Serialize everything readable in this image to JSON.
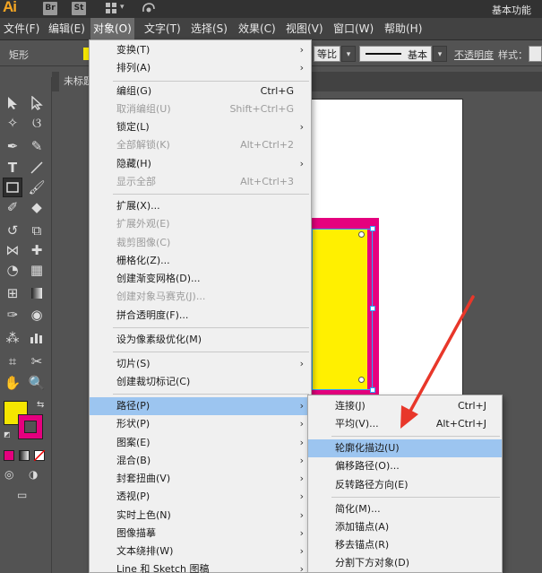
{
  "titlebar": {
    "app_logo": "Ai",
    "badge_br": "Br",
    "badge_st": "St",
    "workspace": "基本功能"
  },
  "menubar": {
    "items": [
      "文件(F)",
      "编辑(E)",
      "对象(O)",
      "文字(T)",
      "选择(S)",
      "效果(C)",
      "视图(V)",
      "窗口(W)",
      "帮助(H)"
    ]
  },
  "controlbar": {
    "shape_label": "矩形",
    "fill_color": "#f5e600",
    "ratio_value": "等比",
    "stroke_style": "基本",
    "opacity_label": "不透明度",
    "style_label": "样式："
  },
  "document": {
    "tab_title": "未标题"
  },
  "colors": {
    "fill": "#f5e600",
    "stroke": "#e5007e",
    "menu_highlight": "#9cc5f0",
    "annotation": "#e8372a"
  },
  "object_menu": {
    "items": [
      {
        "label": "变换(T)",
        "submenu": true
      },
      {
        "label": "排列(A)",
        "submenu": true
      },
      {
        "label": "编组(G)",
        "shortcut": "Ctrl+G"
      },
      {
        "label": "取消编组(U)",
        "shortcut": "Shift+Ctrl+G",
        "disabled": true
      },
      {
        "label": "锁定(L)",
        "submenu": true
      },
      {
        "label": "全部解锁(K)",
        "shortcut": "Alt+Ctrl+2",
        "disabled": true
      },
      {
        "label": "隐藏(H)",
        "submenu": true
      },
      {
        "label": "显示全部",
        "shortcut": "Alt+Ctrl+3",
        "disabled": true
      },
      {
        "label": "扩展(X)..."
      },
      {
        "label": "扩展外观(E)",
        "disabled": true
      },
      {
        "label": "裁剪图像(C)",
        "disabled": true
      },
      {
        "label": "栅格化(Z)..."
      },
      {
        "label": "创建渐变网格(D)..."
      },
      {
        "label": "创建对象马赛克(J)...",
        "disabled": true
      },
      {
        "label": "拼合透明度(F)..."
      },
      {
        "label": "设为像素级优化(M)"
      },
      {
        "label": "切片(S)",
        "submenu": true
      },
      {
        "label": "创建裁切标记(C)"
      },
      {
        "label": "路径(P)",
        "submenu": true,
        "highlighted": true
      },
      {
        "label": "形状(P)",
        "submenu": true
      },
      {
        "label": "图案(E)",
        "submenu": true
      },
      {
        "label": "混合(B)",
        "submenu": true
      },
      {
        "label": "封套扭曲(V)",
        "submenu": true
      },
      {
        "label": "透视(P)",
        "submenu": true
      },
      {
        "label": "实时上色(N)",
        "submenu": true
      },
      {
        "label": "图像描摹",
        "submenu": true
      },
      {
        "label": "文本绕排(W)",
        "submenu": true
      },
      {
        "label": "Line 和 Sketch 图稿",
        "submenu": true
      }
    ]
  },
  "path_submenu": {
    "items": [
      {
        "label": "连接(J)",
        "shortcut": "Ctrl+J"
      },
      {
        "label": "平均(V)...",
        "shortcut": "Alt+Ctrl+J"
      },
      {
        "label": "轮廓化描边(U)",
        "highlighted": true
      },
      {
        "label": "偏移路径(O)..."
      },
      {
        "label": "反转路径方向(E)"
      },
      {
        "label": "简化(M)..."
      },
      {
        "label": "添加锚点(A)"
      },
      {
        "label": "移去锚点(R)"
      },
      {
        "label": "分割下方对象(D)"
      }
    ]
  },
  "tools": [
    "selection-tool",
    "direct-selection-tool",
    "magic-wand-tool",
    "lasso-tool",
    "pen-tool",
    "curvature-tool",
    "type-tool",
    "line-tool",
    "rectangle-tool",
    "paintbrush-tool",
    "shaper-tool",
    "eraser-tool",
    "rotate-tool",
    "scale-tool",
    "width-tool",
    "puppet-warp-tool",
    "shape-builder-tool",
    "perspective-grid-tool",
    "mesh-tool",
    "gradient-tool",
    "eyedropper-tool",
    "blend-tool",
    "symbol-sprayer-tool",
    "column-graph-tool",
    "artboard-tool",
    "slice-tool",
    "hand-tool",
    "zoom-tool"
  ]
}
